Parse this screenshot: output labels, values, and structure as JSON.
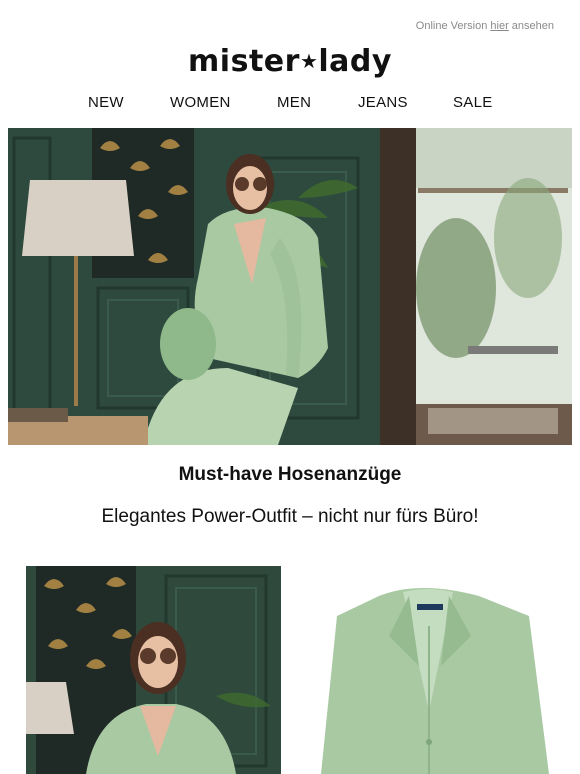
{
  "preheader": {
    "prefix": "Online Version ",
    "link": "hier",
    "suffix": " ansehen"
  },
  "brand": {
    "part1": "mister",
    "star": "★",
    "part2": "lady"
  },
  "nav": [
    {
      "label": "NEW"
    },
    {
      "label": "WOMEN"
    },
    {
      "label": "MEN"
    },
    {
      "label": "JEANS"
    },
    {
      "label": "SALE"
    }
  ],
  "content": {
    "headline": "Must-have Hosenanzüge",
    "subline": "Elegantes Power-Outfit – nicht nur fürs Büro!"
  },
  "colors": {
    "suit": "#a9c9a3",
    "wall": "#2f4a3d",
    "text": "#111111",
    "muted": "#8a8a8a"
  }
}
